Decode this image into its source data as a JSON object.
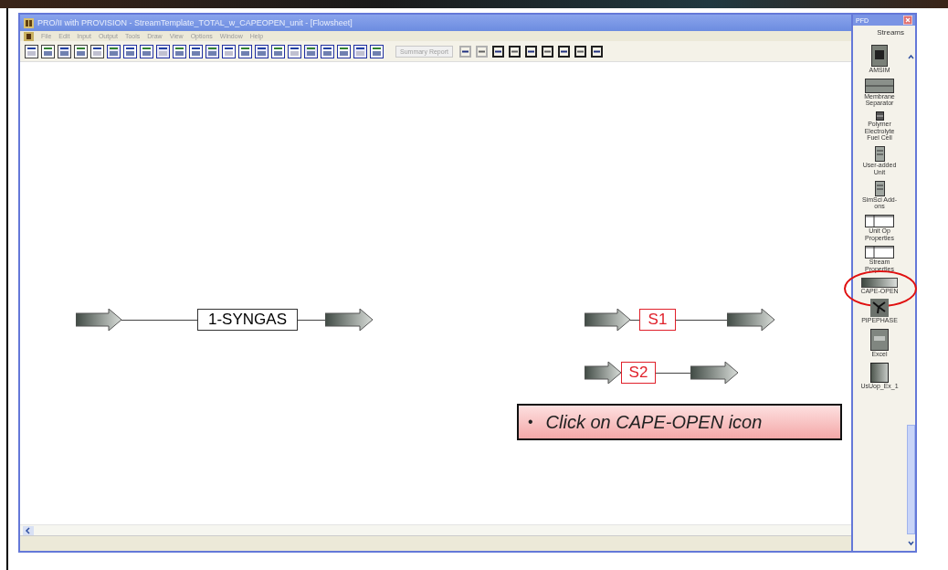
{
  "window": {
    "title": "PRO/II with PROVISION - StreamTemplate_TOTAL_w_CAPEOPEN_unit - [Flowsheet]"
  },
  "menu": [
    "File",
    "Edit",
    "Input",
    "Output",
    "Tools",
    "Draw",
    "View",
    "Options",
    "Window",
    "Help"
  ],
  "toolbar": {
    "combo": "Summary Report"
  },
  "streams": [
    {
      "label": "1-SYNGAS",
      "color": "#000000"
    },
    {
      "label": "S1",
      "color": "#e0202a"
    },
    {
      "label": "S2",
      "color": "#e0202a"
    }
  ],
  "callout": {
    "bullet": "•",
    "text": "Click on CAPE-OPEN icon"
  },
  "palette": {
    "title": "PFD",
    "heading": "Streams",
    "items": [
      {
        "label": "AMSIM",
        "kind": "block",
        "circled": false
      },
      {
        "label": "Membrane Separator",
        "kind": "bar",
        "circled": false
      },
      {
        "label": "Polymer Electrolyte Fuel Cell",
        "kind": "small",
        "circled": false
      },
      {
        "label": "User-added Unit",
        "kind": "slim",
        "circled": false
      },
      {
        "label": "SimSci Add-ons",
        "kind": "slim",
        "circled": false
      },
      {
        "label": "Unit Op Properties",
        "kind": "table",
        "circled": false
      },
      {
        "label": "Stream Properties",
        "kind": "table",
        "circled": false
      },
      {
        "label": "CAPE-OPEN",
        "kind": "gradient",
        "circled": true
      },
      {
        "label": "PIPEPHASE",
        "kind": "network",
        "circled": false
      },
      {
        "label": "Excel",
        "kind": "sheet",
        "circled": false
      },
      {
        "label": "UsUop_Ex_1",
        "kind": "square",
        "circled": false
      }
    ]
  }
}
